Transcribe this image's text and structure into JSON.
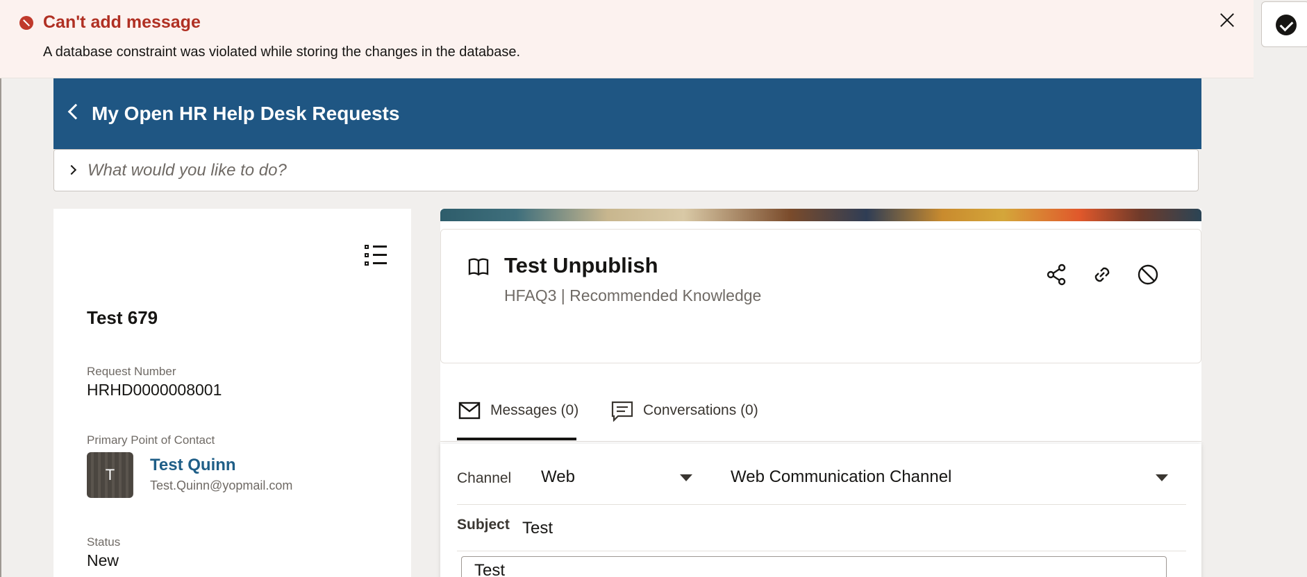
{
  "banner": {
    "title": "Can't add message",
    "message": "A database constraint was violated while storing the changes in the database."
  },
  "header": {
    "title": "My Open HR Help Desk Requests"
  },
  "search": {
    "placeholder": "What would you like to do?"
  },
  "request": {
    "title": "Test 679",
    "number_label": "Request Number",
    "number_value": "HRHD0000008001",
    "contact_label": "Primary Point of Contact",
    "contact_initial": "T",
    "contact_name": "Test Quinn",
    "contact_email": "Test.Quinn@yopmail.com",
    "status_label": "Status",
    "status_value": "New"
  },
  "article": {
    "title": "Test Unpublish",
    "subtitle": "HFAQ3 | Recommended Knowledge"
  },
  "tabs": [
    {
      "label": "Messages (0)",
      "icon": "mail-icon",
      "active": true
    },
    {
      "label": "Conversations (0)",
      "icon": "chat-icon",
      "active": false
    }
  ],
  "message_form": {
    "channel_label": "Channel",
    "channel_value": "Web",
    "channel_option_value": "Web Communication Channel",
    "subject_label": "Subject",
    "subject_value": "Test",
    "body_value": "Test"
  },
  "colors": {
    "header_bg": "#1f5683",
    "error_red": "#b03023",
    "link_blue": "#1f5e87"
  }
}
